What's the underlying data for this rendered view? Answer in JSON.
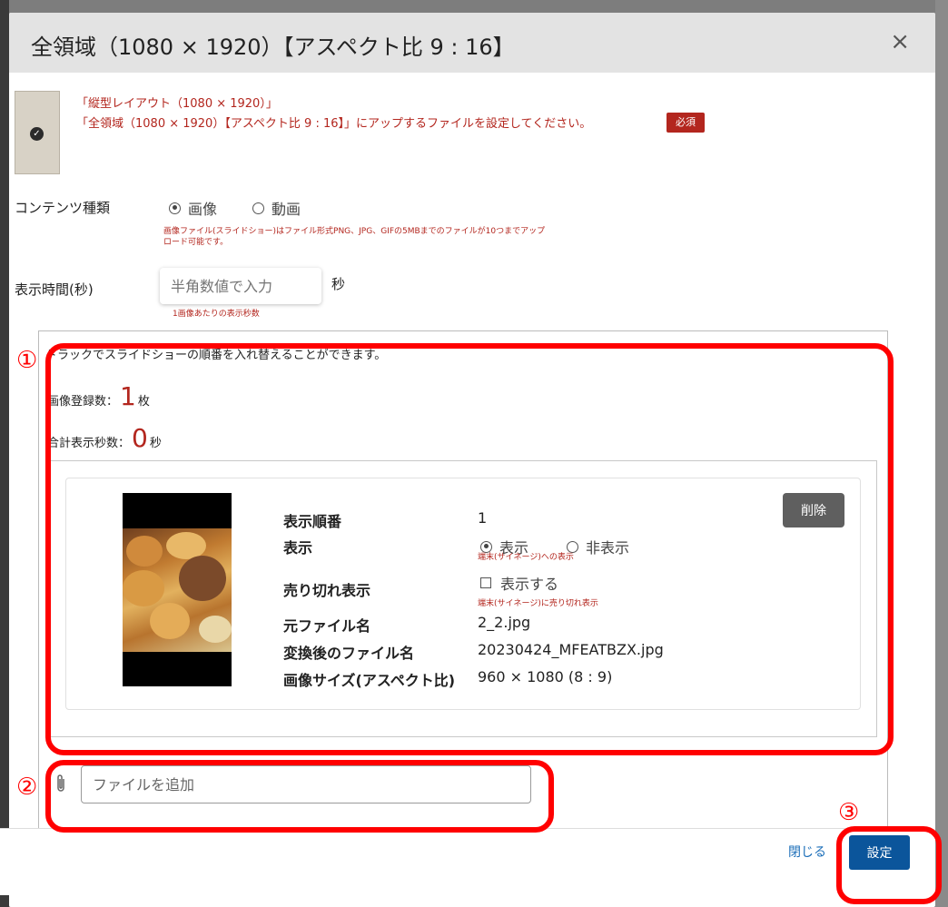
{
  "dialog": {
    "title": "全領域（1080 × 1920）【アスペクト比 9 : 16】",
    "close_symbol": "×"
  },
  "notice": {
    "line1": "「縦型レイアウト（1080 × 1920）」",
    "line2": "「全領域（1080 × 1920）【アスペクト比 9 : 16】」にアップするファイルを設定してください。",
    "required_badge": "必須"
  },
  "content_type": {
    "label": "コンテンツ種類",
    "options": [
      {
        "label": "画像",
        "checked": true
      },
      {
        "label": "動画",
        "checked": false
      }
    ],
    "help_line1": "画像ファイル(スライドショー)はファイル形式PNG、JPG、GIFの5MBまでのファイルが10つまでアップ",
    "help_line2": "ロード可能です。"
  },
  "display_time": {
    "label": "表示時間(秒)",
    "placeholder": "半角数値で入力",
    "unit": "秒",
    "help": "1画像あたりの表示秒数"
  },
  "slideshow": {
    "drag_hint": "ドラックでスライドショーの順番を入れ替えることができます。",
    "count_label": "画像登録数：",
    "count_value": "1",
    "count_unit": "枚",
    "total_label": "合計表示秒数：",
    "total_value": "0",
    "total_unit": "秒"
  },
  "item": {
    "labels": {
      "order": "表示順番",
      "display": "表示",
      "soldout": "売り切れ表示",
      "original_name": "元ファイル名",
      "converted_name": "変換後のファイル名",
      "image_size": "画像サイズ(アスペクト比)"
    },
    "order_value": "1",
    "display_options": [
      {
        "label": "表示",
        "checked": true
      },
      {
        "label": "非表示",
        "checked": false
      }
    ],
    "display_help": "端末(サイネージ)への表示",
    "soldout_checkbox_label": "表示する",
    "soldout_checked": false,
    "soldout_help": "端末(サイネージ)に売り切れ表示",
    "original_name_value": "2_2.jpg",
    "converted_name_value": "20230424_MFEATBZX.jpg",
    "image_size_value": "960 × 1080 (8 : 9)",
    "delete_label": "削除"
  },
  "add_file": {
    "placeholder": "ファイルを追加"
  },
  "footer": {
    "close_label": "閉じる",
    "set_label": "設定"
  },
  "annotations": [
    "①",
    "②",
    "③"
  ],
  "colors": {
    "accent_red": "#b3261e",
    "annotation_red": "#ff0000",
    "primary_blue": "#0b559b",
    "link_blue": "#1a6db8"
  }
}
